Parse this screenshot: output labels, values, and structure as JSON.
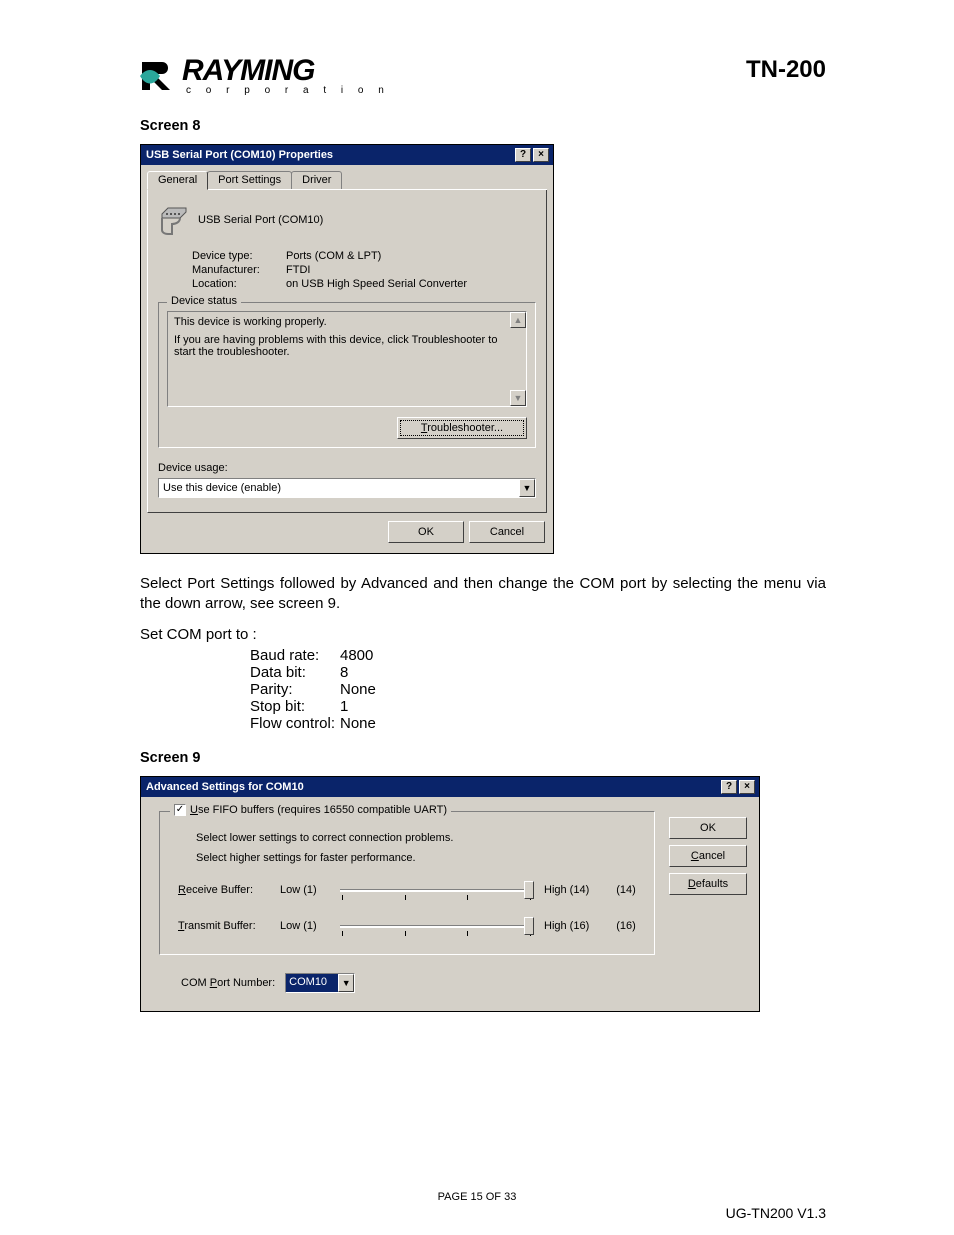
{
  "header": {
    "brand": "RAYMING",
    "brand_sub": "c o r p o r a t i o n",
    "model": "TN-200"
  },
  "screen8": {
    "label": "Screen 8",
    "dialog": {
      "title": "USB Serial Port (COM10) Properties",
      "help_btn": "?",
      "close_btn": "×",
      "tabs": [
        "General",
        "Port Settings",
        "Driver"
      ],
      "device_name": "USB Serial Port (COM10)",
      "device_type_label": "Device type:",
      "device_type": "Ports (COM & LPT)",
      "manufacturer_label": "Manufacturer:",
      "manufacturer": "FTDI",
      "location_label": "Location:",
      "location": "on USB High Speed Serial Converter",
      "device_status_label": "Device status",
      "status_line1": "This device is working properly.",
      "status_line2": "If you are having problems with this device, click Troubleshooter to start the troubleshooter.",
      "troubleshooter_btn": "Troubleshooter...",
      "device_usage_label": "Device usage:",
      "device_usage_value": "Use this device (enable)",
      "ok_btn": "OK",
      "cancel_btn": "Cancel"
    }
  },
  "body": {
    "para1": "Select Port Settings followed by Advanced and then change the COM port by selecting the menu via the down arrow, see screen 9.",
    "set_com_heading": "Set COM port to :",
    "settings": {
      "baud_label": "Baud rate:",
      "baud": "4800",
      "databit_label": "Data bit:",
      "databit": "8",
      "parity_label": "Parity:",
      "parity": "None",
      "stopbit_label": "Stop bit:",
      "stopbit": "1",
      "flow_label": "Flow control:",
      "flow": "None"
    }
  },
  "screen9": {
    "label": "Screen 9",
    "dialog": {
      "title": "Advanced Settings for COM10",
      "help_btn": "?",
      "close_btn": "×",
      "fifo_label_pre": "U",
      "fifo_label": "se FIFO buffers (requires 16550 compatible UART)",
      "hint1": "Select lower settings to correct connection problems.",
      "hint2": "Select higher settings for faster performance.",
      "recv_label_pre": "R",
      "recv_label": "eceive Buffer:",
      "recv_low": "Low (1)",
      "recv_high": "High (14)",
      "recv_val": "(14)",
      "xmit_label_pre": "T",
      "xmit_label": "ransmit Buffer:",
      "xmit_low": "Low (1)",
      "xmit_high": "High (16)",
      "xmit_val": "(16)",
      "comport_label_pre": "P",
      "comport_label_pre2": "COM ",
      "comport_label": "ort Number:",
      "comport_value": "COM10",
      "ok_btn": "OK",
      "cancel_btn_pre": "C",
      "cancel_btn": "ancel",
      "defaults_btn_pre": "D",
      "defaults_btn": "efaults"
    }
  },
  "footer": {
    "page": "PAGE 15 OF 33",
    "docver": "UG-TN200 V1.3"
  }
}
